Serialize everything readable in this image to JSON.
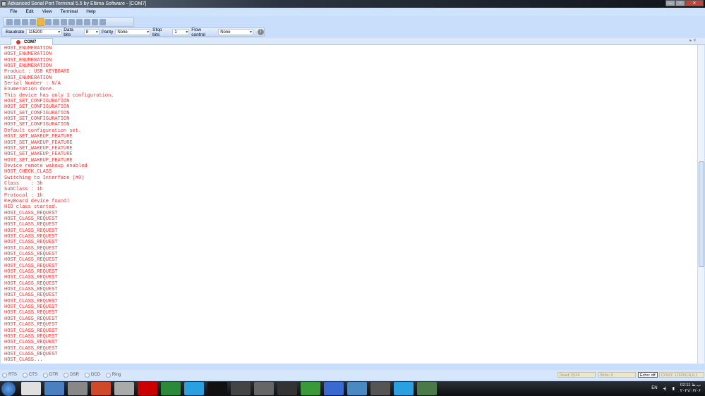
{
  "window": {
    "title": "Advanced Serial Port Terminal 5.5 by Eltima Software - [COM7]",
    "minimize": "—",
    "maximize": "▫",
    "close": "✕"
  },
  "menu": [
    "File",
    "Edit",
    "View",
    "Terminal",
    "Help"
  ],
  "settings": {
    "baudrate_label": "Baudrate",
    "baudrate": "115200",
    "databits_label": "Data bits",
    "databits": "8",
    "parity_label": "Parity",
    "parity": "None",
    "stopbits_label": "Stop bits",
    "stopbits": "1",
    "flow_label": "Flow control",
    "flow": "None"
  },
  "tab": {
    "label": "COM7"
  },
  "terminal_lines": [
    "HOST_ENUMERATION",
    "HOST_ENUMERATION",
    "HOST_ENUMERATION",
    "HOST_ENUMERATION",
    "Product : USB KEYBOARD",
    "HOST_ENUMERATION",
    "Serial Number : N/A",
    "Enumeration done.",
    "This device has only 1 configuration.",
    "HOST_SET_CONFIGURATION",
    "HOST_SET_CONFIGURATION",
    "HOST_SET_CONFIGURATION",
    "HOST_SET_CONFIGURATION",
    "HOST_SET_CONFIGURATION",
    "Default configuration set.",
    "HOST_SET_WAKEUP_FEATURE",
    "HOST_SET_WAKEUP_FEATURE",
    "HOST_SET_WAKEUP_FEATURE",
    "HOST_SET_WAKEUP_FEATURE",
    "HOST_SET_WAKEUP_FEATURE",
    "Device remote wakeup enabled",
    "HOST_CHECK_CLASS",
    "Switching to Interface (#0)",
    "Class    : 3h",
    "SubClass : 1h",
    "Protocol : 1h",
    "KeyBoard device found!",
    "HID class started.",
    "HOST_CLASS_REQUEST",
    "HOST_CLASS_REQUEST",
    "HOST_CLASS_REQUEST",
    "HOST_CLASS_REQUEST",
    "HOST_CLASS_REQUEST",
    "HOST_CLASS_REQUEST",
    "HOST_CLASS_REQUEST",
    "HOST_CLASS_REQUEST",
    "HOST_CLASS_REQUEST",
    "HOST_CLASS_REQUEST",
    "HOST_CLASS_REQUEST",
    "HOST_CLASS_REQUEST",
    "HOST_CLASS_REQUEST",
    "HOST_CLASS_REQUEST",
    "HOST_CLASS_REQUEST",
    "HOST_CLASS_REQUEST",
    "HOST_CLASS_REQUEST",
    "HOST_CLASS_REQUEST",
    "HOST_CLASS_REQUEST",
    "HOST_CLASS_REQUEST",
    "HOST_CLASS_REQUEST",
    "HOST_CLASS_REQUEST",
    "HOST_CLASS_REQUEST",
    "HOST_CLASS_REQUEST",
    "HOST_CLASS_REQUEST",
    "HOST_CLASS..."
  ],
  "signals": [
    "RTS",
    "CTS",
    "DTR",
    "DSR",
    "DCD",
    "Ring"
  ],
  "status": {
    "read": "Read: 5534",
    "write": "Write: 0",
    "echo": "Echo: off",
    "port": "COM7: 115200,N,8,1"
  },
  "taskbar": {
    "apps": [
      "chrome",
      "explorer",
      "unity",
      "matlab",
      "x",
      "CV AVR",
      "ie",
      "MX",
      "app",
      "app",
      "terminal",
      "USB",
      "clover",
      "app",
      "app",
      "P",
      "MX",
      "app"
    ],
    "lang": "EN",
    "time": "02:11 ب.ظ",
    "date": "۲۰۲۱/۰۲/۰۶"
  }
}
